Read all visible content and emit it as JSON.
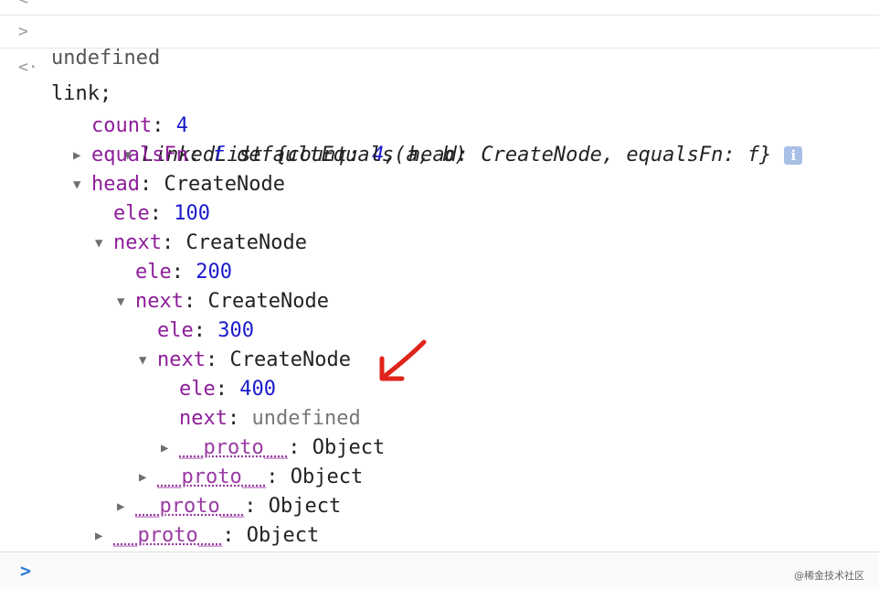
{
  "previous_output": "undefined",
  "input": {
    "prompt": ">",
    "command": "link;"
  },
  "result": {
    "return_marker": "<·",
    "summary": {
      "class": "LinkedList",
      "open": " {",
      "k_count": "count",
      "v_count": "4",
      "k_head": "head",
      "v_head": "CreateNode",
      "k_equals": "equalsFn",
      "v_equals": "f",
      "close": "}"
    },
    "info_badge": "i",
    "count": {
      "key": "count",
      "value": "4"
    },
    "equalsFn": {
      "key": "equalsFn",
      "fn_marker": "f",
      "signature": "defaultEquals(a, b)"
    },
    "head": {
      "key": "head",
      "type": "CreateNode"
    },
    "node1": {
      "ele_key": "ele",
      "ele": "100",
      "next_key": "next",
      "next_type": "CreateNode"
    },
    "node2": {
      "ele_key": "ele",
      "ele": "200",
      "next_key": "next",
      "next_type": "CreateNode"
    },
    "node3": {
      "ele_key": "ele",
      "ele": "300",
      "next_key": "next",
      "next_type": "CreateNode"
    },
    "node4": {
      "ele_key": "ele",
      "ele": "400",
      "next_key": "next",
      "next_value": "undefined"
    },
    "proto_key": "__proto__",
    "proto_value": "Object"
  },
  "console_prompt": ">",
  "watermark": "@稀金技术社区",
  "annotation_color": "#e0241b"
}
